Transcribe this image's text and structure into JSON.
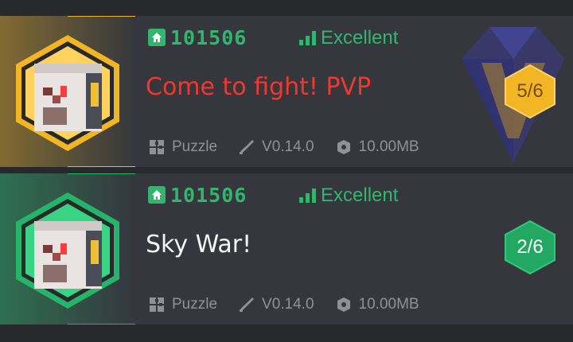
{
  "rooms": [
    {
      "id": "101506",
      "signal": "Excellent",
      "title": "Come to fight!  PVP",
      "category": "Puzzle",
      "version": "V0.14.0",
      "size": "10.00MB",
      "players": "5/6",
      "accent": "#f2b523",
      "title_color": "#f0382f"
    },
    {
      "id": "101506",
      "signal": "Excellent",
      "title": "Sky War!",
      "category": "Puzzle",
      "version": "V0.14.0",
      "size": "10.00MB",
      "players": "2/6",
      "accent": "#26b46a",
      "title_color": "#f4f4f4"
    }
  ],
  "icons": {
    "home": "home-icon",
    "signal": "signal-bars-icon",
    "category": "puzzle-icon",
    "version": "sword-icon",
    "size": "package-icon",
    "emblem": "pvp-diamond-emblem"
  },
  "colors": {
    "background": "#27292d",
    "card": "#35373d",
    "text_green": "#33b56f",
    "meta_gray": "#8f9196"
  }
}
